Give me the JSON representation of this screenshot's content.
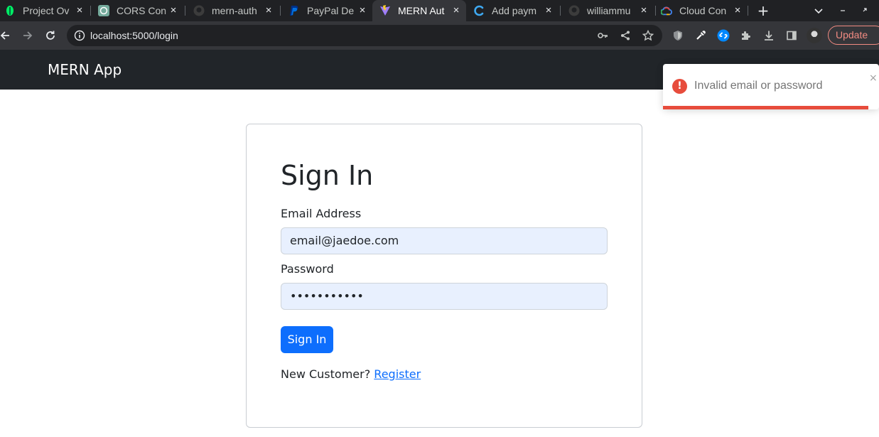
{
  "browser": {
    "tabs": [
      {
        "title": "Project Ov",
        "favicon": "mongodb-leaf-icon",
        "active": false
      },
      {
        "title": "CORS Con",
        "favicon": "openai-icon",
        "active": false
      },
      {
        "title": "mern-auth",
        "favicon": "github-icon",
        "active": false
      },
      {
        "title": "PayPal De",
        "favicon": "paypal-icon",
        "active": false
      },
      {
        "title": "MERN Aut",
        "favicon": "vite-icon",
        "active": true
      },
      {
        "title": "Add paym",
        "favicon": "edge-c-icon",
        "active": false
      },
      {
        "title": "williammu",
        "favicon": "github-icon",
        "active": false
      },
      {
        "title": "Cloud Con",
        "favicon": "google-cloud-icon",
        "active": false
      }
    ],
    "url": "localhost:5000/login",
    "update_label": "Update"
  },
  "navbar": {
    "brand": "MERN App"
  },
  "login": {
    "title": "Sign In",
    "email_label": "Email Address",
    "email_value": "email@jaedoe.com",
    "password_label": "Password",
    "password_value": "•••••••••••",
    "submit_label": "Sign In",
    "new_customer_text": "New Customer?",
    "register_link": "Register"
  },
  "toast": {
    "message": "Invalid email or password",
    "icon": "!",
    "close": "×",
    "progress": 0.95,
    "color": "#e74c3c"
  }
}
